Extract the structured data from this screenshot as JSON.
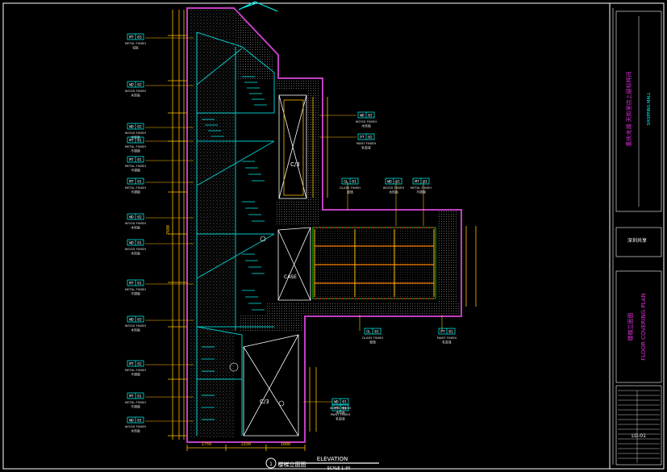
{
  "drawing": {
    "scale_title": "ELEVATION",
    "scale_subtitle": "SCALE 1:30",
    "view_no": "1",
    "view_name": "楼梯立面图"
  },
  "title_block": {
    "project_name": "重庆龙湖 天街里店上层标样间",
    "project_en": "SHOPPING MALL",
    "designer_name": "深圳共享",
    "sheet_title_cn": "楼梯立面图",
    "sheet_title_en": "FLOOR COVERING PLAN",
    "sheet_no": "LG-01"
  },
  "left_tags": [
    {
      "code": "MT",
      "num": "03",
      "note": "METAL FINISH",
      "sub": "铝板"
    },
    {
      "code": "WD",
      "num": "02",
      "note": "WOOD FINISH",
      "sub": "木饰面"
    },
    {
      "code": "WD",
      "num": "02",
      "note": "WOOD FINISH",
      "sub": "木饰面"
    },
    {
      "code": "MT",
      "num": "01",
      "note": "METAL FINISH",
      "sub": "不锈钢"
    },
    {
      "code": "MT",
      "num": "01",
      "note": "METAL FINISH",
      "sub": "不锈钢"
    },
    {
      "code": "MT",
      "num": "01",
      "note": "METAL FINISH",
      "sub": "不锈钢"
    },
    {
      "code": "WD",
      "num": "02",
      "note": "WOOD FINISH",
      "sub": "木饰面"
    },
    {
      "code": "WD",
      "num": "01",
      "note": "WOOD FINISH",
      "sub": "木饰面"
    },
    {
      "code": "MT",
      "num": "01",
      "note": "METAL FINISH",
      "sub": "不锈钢"
    },
    {
      "code": "WD",
      "num": "03",
      "note": "WOOD FINISH",
      "sub": "木饰面"
    },
    {
      "code": "MT",
      "num": "02",
      "note": "METAL FINISH",
      "sub": "不锈钢"
    },
    {
      "code": "MT",
      "num": "01",
      "note": "METAL FINISH",
      "sub": "不锈钢"
    },
    {
      "code": "WD",
      "num": "01",
      "note": "WOOD FINISH",
      "sub": "木饰面"
    }
  ],
  "right_tags": [
    {
      "code": "WD",
      "num": "02",
      "note": "WOOD FINISH",
      "sub": "木饰面"
    },
    {
      "code": "PT",
      "num": "02",
      "note": "PAINT FINISH",
      "sub": "乳胶漆"
    },
    {
      "code": "GL",
      "num": "01",
      "note": "GLASS FINISH",
      "sub": "玻璃"
    },
    {
      "code": "WD",
      "num": "01",
      "note": "WOOD FINISH",
      "sub": "木饰面"
    },
    {
      "code": "MT",
      "num": "01",
      "note": "METAL FINISH",
      "sub": "不锈钢"
    },
    {
      "code": "GL",
      "num": "01",
      "note": "GLASS FINISH",
      "sub": "玻璃"
    },
    {
      "code": "PT",
      "num": "01",
      "note": "PAINT FINISH",
      "sub": "乳胶漆"
    },
    {
      "code": "WD",
      "num": "01",
      "note": "WOOD FINISH",
      "sub": "木饰面"
    },
    {
      "code": "PT",
      "num": "01",
      "note": "PAINT FINISH",
      "sub": "乳胶漆"
    }
  ],
  "cabinet_labels": {
    "upper": "C/3",
    "lower": "C/3",
    "mid": "CASE"
  },
  "dims": {
    "bottom": [
      "1750",
      "2150",
      "1600"
    ],
    "side": "7600"
  },
  "colors": {
    "bg": "#000000",
    "wall": "#c040c0",
    "stair": "#00c8c8",
    "dim": "#ffc000",
    "frame": "#ffffff",
    "glass": "#00ff00",
    "shelf": "#ff8000",
    "tag": "#00ffff",
    "block": "#e030e0"
  }
}
